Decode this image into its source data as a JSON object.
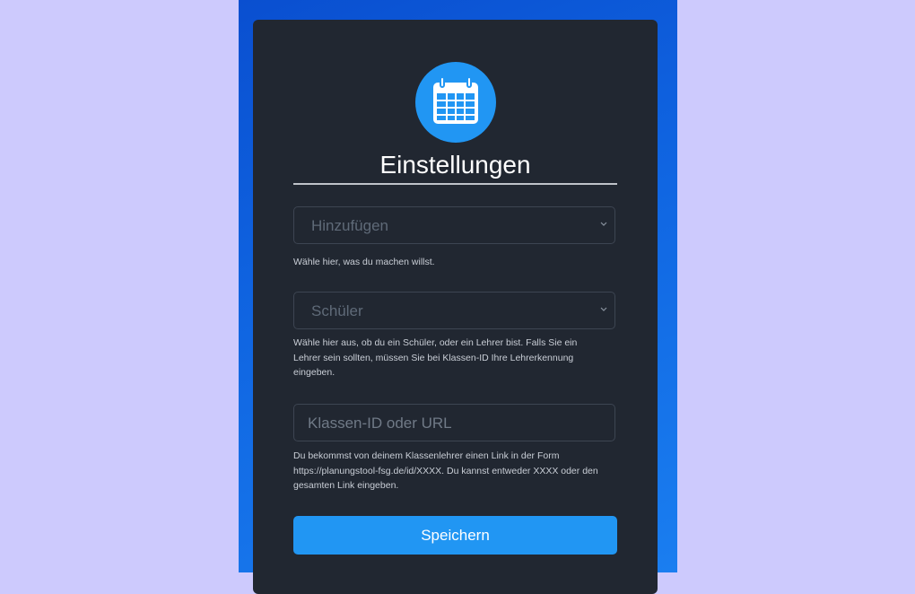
{
  "page": {
    "background_color": "#cdcafd",
    "panel_color": "#0f63e0",
    "card_color": "#212731",
    "accent_color": "#2196f3"
  },
  "header": {
    "icon": "calendar-icon",
    "title": "Einstellungen"
  },
  "action_select": {
    "value": "Hinzufügen",
    "help": "Wähle hier, was du machen willst."
  },
  "role_select": {
    "value": "Schüler",
    "help": "Wähle hier aus, ob du ein Schüler, oder ein Lehrer bist. Falls Sie ein Lehrer sein sollten, müssen Sie bei Klassen-ID Ihre Lehrerkennung eingeben."
  },
  "class_input": {
    "placeholder": "Klassen-ID oder URL",
    "help": "Du bekommst von deinem Klassenlehrer einen Link in der Form https://planungstool-fsg.de/id/XXXX. Du kannst entweder XXXX oder den gesamten Link eingeben."
  },
  "save_button": {
    "label": "Speichern"
  }
}
